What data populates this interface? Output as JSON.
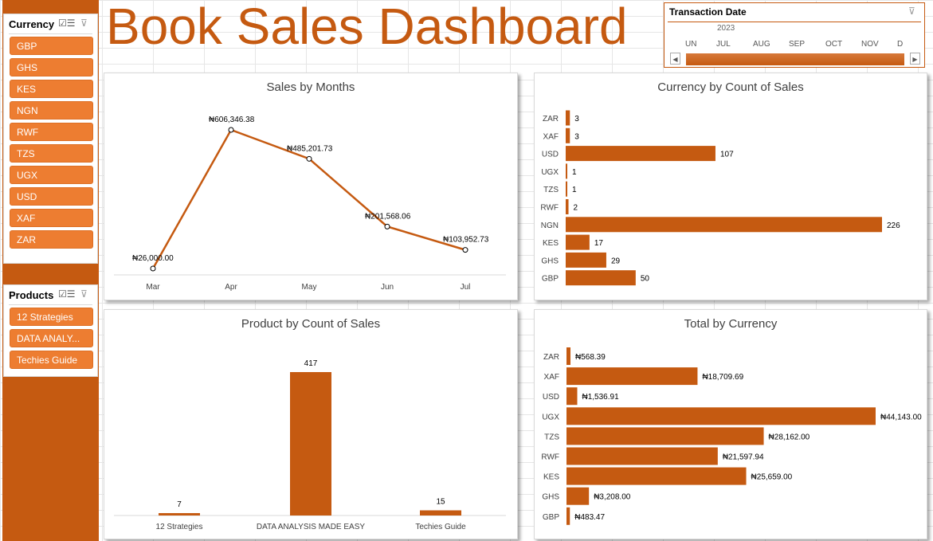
{
  "dashboard": {
    "title": "Book Sales Dashboard"
  },
  "slicers": {
    "currency": {
      "title": "Currency",
      "items": [
        "GBP",
        "GHS",
        "KES",
        "NGN",
        "RWF",
        "TZS",
        "UGX",
        "USD",
        "XAF",
        "ZAR"
      ]
    },
    "products": {
      "title": "Products",
      "items": [
        "12 Strategies",
        "DATA ANALY...",
        "Techies Guide"
      ]
    },
    "icons": {
      "multiselect": "multi-select-icon",
      "clear": "clear-filter-icon"
    }
  },
  "timeline": {
    "title": "Transaction Date",
    "year": "2023",
    "months": [
      "UN",
      "JUL",
      "AUG",
      "SEP",
      "OCT",
      "NOV",
      "D"
    ]
  },
  "colors": {
    "accent": "#c55a11",
    "slicer_button": "#ed7d31"
  },
  "chart_data": [
    {
      "type": "line",
      "title": "Sales by Months",
      "categories": [
        "Mar",
        "Apr",
        "May",
        "Jun",
        "Jul"
      ],
      "values": [
        26000.0,
        606346.38,
        485201.73,
        201568.06,
        103952.73
      ],
      "labels": [
        "₦26,000.00",
        "₦606,346.38",
        "₦485,201.73",
        "₦201,568.06",
        "₦103,952.73"
      ]
    },
    {
      "type": "bar",
      "orientation": "horizontal",
      "title": "Currency by Count of Sales",
      "categories": [
        "ZAR",
        "XAF",
        "USD",
        "UGX",
        "TZS",
        "RWF",
        "NGN",
        "KES",
        "GHS",
        "GBP"
      ],
      "values": [
        3,
        3,
        107,
        1,
        1,
        2,
        226,
        17,
        29,
        50
      ]
    },
    {
      "type": "bar",
      "title": "Product by Count of Sales",
      "categories": [
        "12 Strategies",
        "DATA ANALYSIS MADE EASY",
        "Techies Guide"
      ],
      "values": [
        7,
        417,
        15
      ]
    },
    {
      "type": "bar",
      "orientation": "horizontal",
      "title": "Total by Currency",
      "categories": [
        "ZAR",
        "XAF",
        "USD",
        "UGX",
        "TZS",
        "RWF",
        "KES",
        "GHS",
        "GBP"
      ],
      "values": [
        568.39,
        18709.69,
        1536.91,
        44143.0,
        28162.0,
        21597.94,
        25659.0,
        3208.0,
        483.47
      ],
      "labels": [
        "₦568.39",
        "₦18,709.69",
        "₦1,536.91",
        "₦44,143.00",
        "₦28,162.00",
        "₦21,597.94",
        "₦25,659.00",
        "₦3,208.00",
        "₦483.47"
      ]
    }
  ]
}
